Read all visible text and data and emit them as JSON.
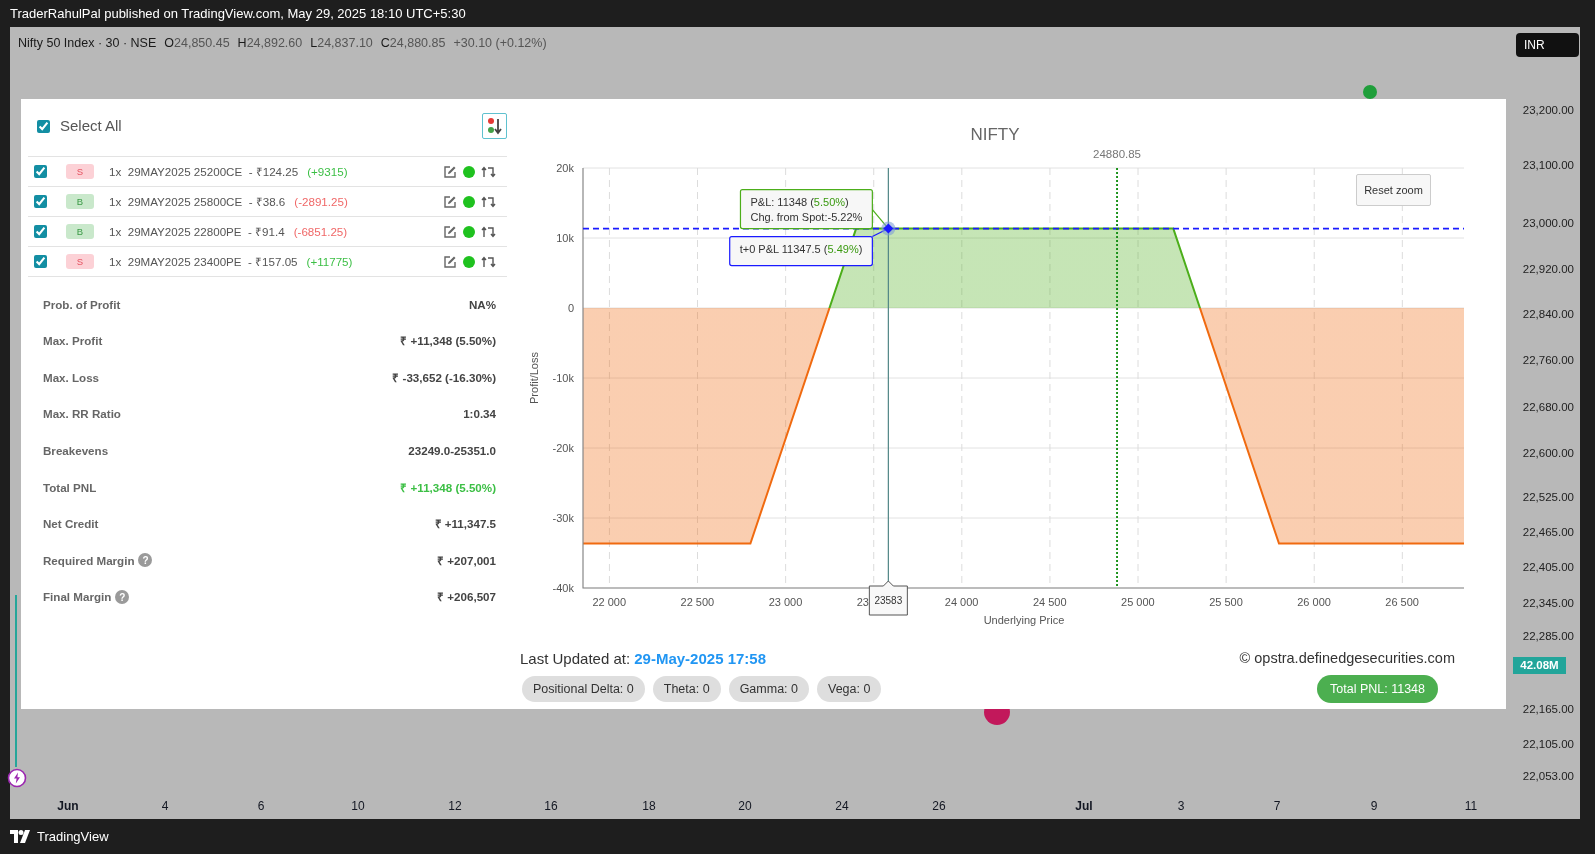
{
  "header": {
    "title": "TraderRahulPal published on TradingView.com, May 29, 2025 18:10 UTC+5:30"
  },
  "legend": {
    "symbol": "Nifty 50 Index · 30 · NSE",
    "ohlc": [
      {
        "key": "O",
        "value": "24,850.45"
      },
      {
        "key": "H",
        "value": "24,892.60"
      },
      {
        "key": "L",
        "value": "24,837.10"
      },
      {
        "key": "C",
        "value": "24,880.85"
      }
    ],
    "change": "+30.10 (+0.12%)"
  },
  "currency_button": "INR",
  "price_axis": [
    "23,200.00",
    "23,100.00",
    "23,000.00",
    "22,920.00",
    "22,840.00",
    "22,760.00",
    "22,680.00",
    "22,600.00",
    "22,525.00",
    "22,465.00",
    "22,405.00",
    "22,345.00",
    "22,285.00",
    "22,165.00",
    "22,105.00",
    "22,053.00"
  ],
  "volume_badge": "42.08M",
  "time_axis": [
    {
      "label": "Jun",
      "kind": "month"
    },
    {
      "label": "4",
      "kind": "day"
    },
    {
      "label": "6",
      "kind": "day"
    },
    {
      "label": "10",
      "kind": "day"
    },
    {
      "label": "12",
      "kind": "day"
    },
    {
      "label": "16",
      "kind": "day"
    },
    {
      "label": "18",
      "kind": "day"
    },
    {
      "label": "20",
      "kind": "day"
    },
    {
      "label": "24",
      "kind": "day"
    },
    {
      "label": "26",
      "kind": "day"
    },
    {
      "label": "Jul",
      "kind": "month"
    },
    {
      "label": "3",
      "kind": "day"
    },
    {
      "label": "7",
      "kind": "day"
    },
    {
      "label": "9",
      "kind": "day"
    },
    {
      "label": "11",
      "kind": "day"
    }
  ],
  "panel": {
    "select_all": {
      "label": "Select All",
      "checked": true
    },
    "legs": [
      {
        "checked": true,
        "side": "S",
        "kind": "sell",
        "desc": "1x  29MAY2025 25200CE  - ₹124.25",
        "pnl": "(+9315)",
        "gain": true
      },
      {
        "checked": true,
        "side": "B",
        "kind": "buy",
        "desc": "1x  29MAY2025 25800CE  - ₹38.6",
        "pnl": "(-2891.25)",
        "gain": false
      },
      {
        "checked": true,
        "side": "B",
        "kind": "buy",
        "desc": "1x  29MAY2025 22800PE  - ₹91.4",
        "pnl": "(-6851.25)",
        "gain": false
      },
      {
        "checked": true,
        "side": "S",
        "kind": "sell",
        "desc": "1x  29MAY2025 23400PE  - ₹157.05",
        "pnl": "(+11775)",
        "gain": true
      }
    ],
    "stats": [
      {
        "label": "Prob. of Profit",
        "value": "NA%",
        "gain": false
      },
      {
        "label": "Max. Profit",
        "value": "₹ +11,348 (5.50%)",
        "gain": false
      },
      {
        "label": "Max. Loss",
        "value": "₹ -33,652 (-16.30%)",
        "gain": false
      },
      {
        "label": "Max. RR Ratio",
        "value": "1:0.34",
        "gain": false
      },
      {
        "label": "Breakevens",
        "value": "23249.0-25351.0",
        "gain": false
      },
      {
        "label": "Total PNL",
        "value": "₹ +11,348 (5.50%)",
        "gain": true
      },
      {
        "label": "Net Credit",
        "value": "₹ +11,347.5",
        "gain": false
      },
      {
        "label": "Required Margin",
        "value": "₹ +207,001",
        "gain": false,
        "help": "?"
      },
      {
        "label": "Final Margin",
        "value": "₹ +206,507",
        "gain": false,
        "help": "?"
      }
    ]
  },
  "chart": {
    "reset_button": "Reset zoom",
    "chart_data": {
      "type": "area",
      "title": "NIFTY",
      "xlabel": "Underlying Price",
      "ylabel": "Profit/Loss",
      "x": [
        21850,
        22800,
        23400,
        25200,
        25800,
        26850
      ],
      "series": [
        {
          "color": "#f06a10",
          "values": [
            -33652,
            -33652,
            11348,
            11348,
            -33652,
            -33652
          ]
        },
        {
          "type": "line",
          "line_style": "dashed",
          "color": "#1a1aff",
          "values": [
            11347.5,
            11347.5,
            11347.5,
            11347.5,
            11347.5,
            11347.5
          ]
        }
      ],
      "grid": true,
      "xlim": [
        21850,
        26850
      ],
      "ylim": [
        -40000,
        20000
      ],
      "xticks": [
        {
          "value": 22000,
          "label": "22 000"
        },
        {
          "value": 22500,
          "label": "22 500"
        },
        {
          "value": 23000,
          "label": "23 000"
        },
        {
          "value": 24000,
          "label": "24 000"
        },
        {
          "value": 24500,
          "label": "24 500"
        },
        {
          "value": 25000,
          "label": "25 000"
        },
        {
          "value": 25500,
          "label": "25 500"
        },
        {
          "value": 26000,
          "label": "26 000"
        },
        {
          "value": 26500,
          "label": "26 500"
        }
      ],
      "yticks": [
        {
          "value": 20000,
          "label": "20k"
        },
        {
          "value": 10000,
          "label": "10k"
        },
        {
          "value": 0,
          "label": "0"
        },
        {
          "value": -10000,
          "label": "-10k"
        },
        {
          "value": -20000,
          "label": "-20k"
        },
        {
          "value": -30000,
          "label": "-30k"
        },
        {
          "value": -40000,
          "label": "-40k"
        }
      ],
      "ref_lines": [
        {
          "axis": "x",
          "value": 24880.85,
          "label": "24880.85",
          "color": "#0a8a0a"
        },
        {
          "axis": "x",
          "value": 23583,
          "label": "23583",
          "color": "#4f8585"
        }
      ]
    },
    "covered_tick_label": "23",
    "tooltips": [
      {
        "kind": "expiry",
        "lines": [
          {
            "lead": "P&L: 11348 (",
            "pct": "5.50%",
            "tail": ")"
          },
          {
            "lead": "Chg. from Spot:-5.22%"
          }
        ]
      },
      {
        "kind": "t0",
        "lines": [
          {
            "lead": "t+0 P&L 11347.5 (",
            "pct": "5.49%",
            "tail": ")"
          }
        ]
      }
    ]
  },
  "footer_info": {
    "updated_label": "Last Updated at:",
    "updated_value": "29-May-2025 17:58",
    "copyright": "© opstra.definedgesecurities.com",
    "greeks": [
      "Positional Delta: 0",
      "Theta: 0",
      "Gamma: 0",
      "Vega: 0"
    ],
    "total_pnl": "Total PNL: 11348"
  },
  "brand": "TradingView"
}
